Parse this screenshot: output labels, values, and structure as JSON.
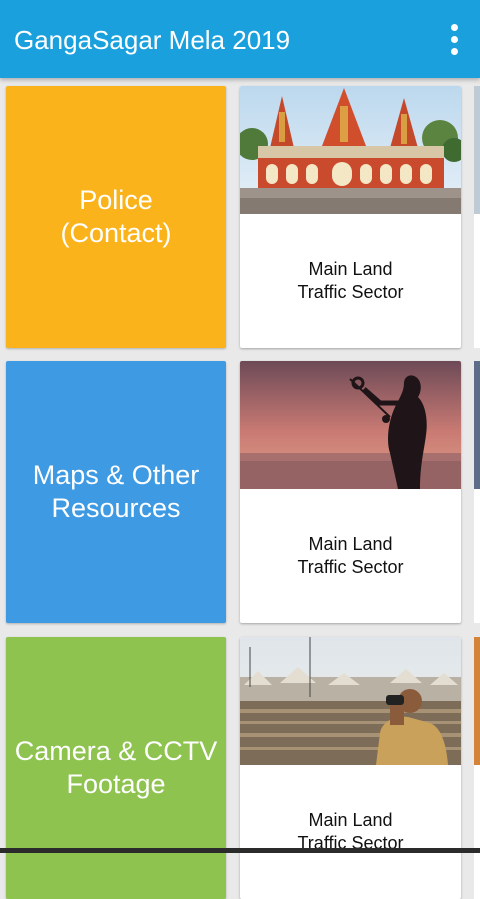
{
  "appbar": {
    "title": "GangaSagar Mela 2019",
    "menu_icon": "more-vert-icon"
  },
  "tiles": [
    {
      "label": "Police\n(Contact)",
      "color": "#fbb31b"
    },
    {
      "label": "Maps & Other\nResources",
      "color": "#3d9ae3"
    },
    {
      "label": "Camera & CCTV\nFootage",
      "color": "#8ec34f"
    }
  ],
  "cards": [
    {
      "caption": "Main Land\nTraffic Sector",
      "image": "temple-photo"
    },
    {
      "caption": "Main Land\nTraffic Sector",
      "image": "sunset-pilgrim-photo"
    },
    {
      "caption": "Main Land\nTraffic Sector",
      "image": "crowd-binoculars-photo"
    }
  ]
}
